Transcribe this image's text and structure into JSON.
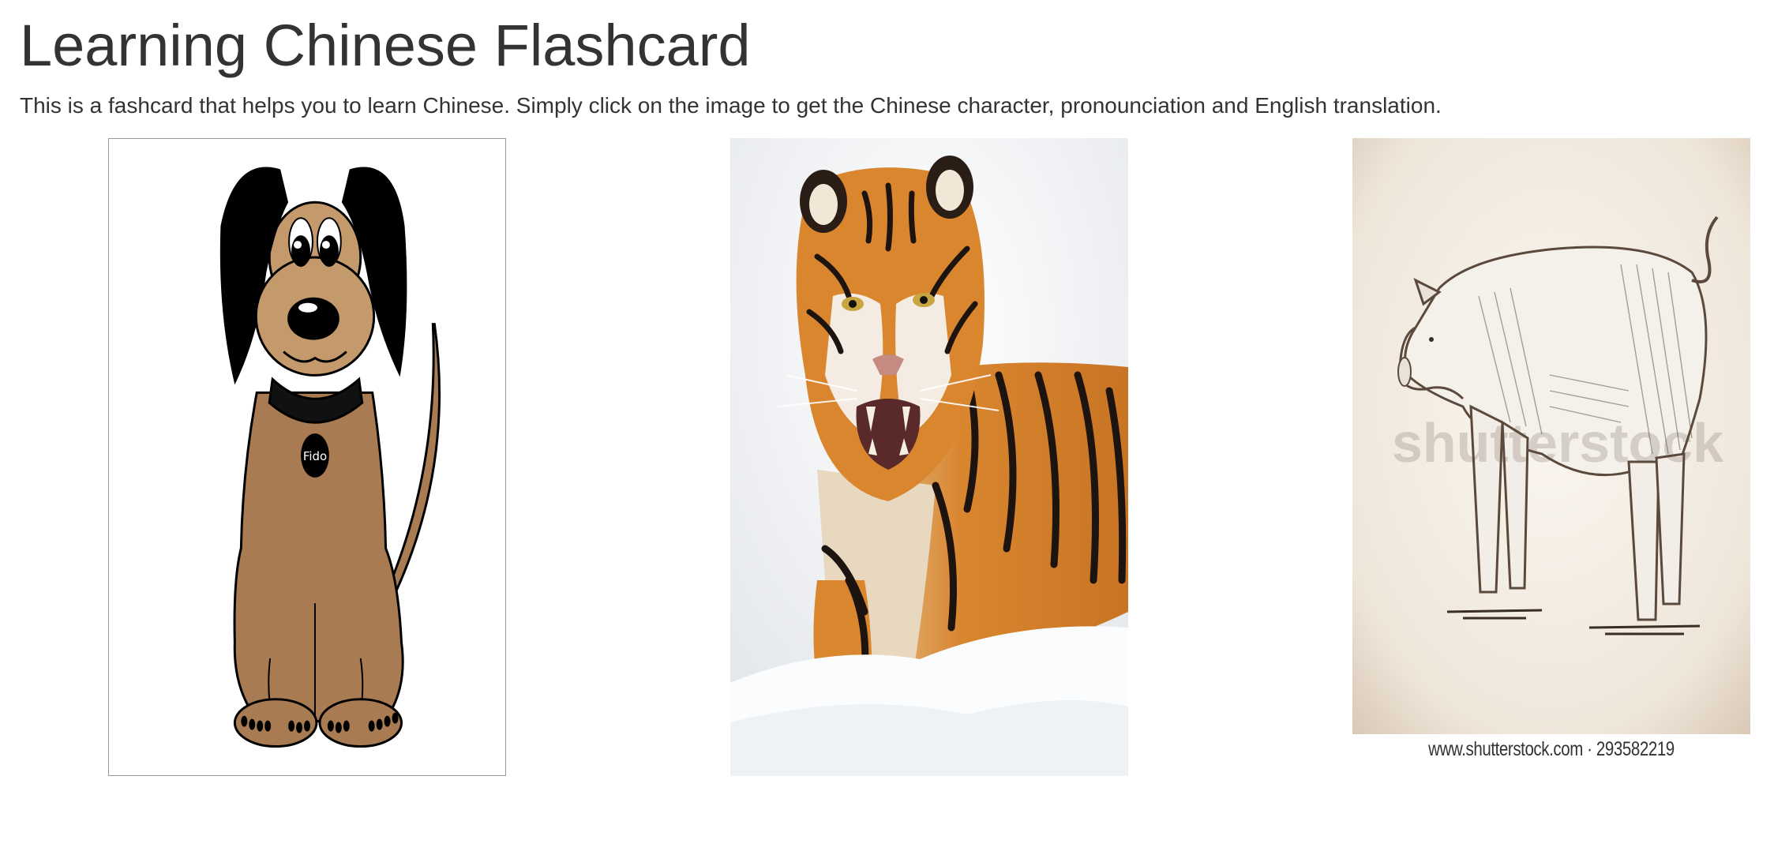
{
  "page": {
    "title": "Learning Chinese Flashcard",
    "description": "This is a fashcard that helps you to learn Chinese. Simply click on the image to get the Chinese character, pronounciation and English translation."
  },
  "cards": [
    {
      "name": "dog",
      "collar_tag": "Fido",
      "icon": "dog-cartoon-image"
    },
    {
      "name": "tiger",
      "icon": "tiger-photo-image"
    },
    {
      "name": "pig",
      "caption": "www.shutterstock.com · 293582219",
      "watermark": "shutterstock",
      "icon": "pig-engraving-image"
    }
  ],
  "colors": {
    "text": "#333333",
    "dog_body": "#a97b52",
    "dog_face": "#c49a6c",
    "tiger_orange": "#d9862f",
    "pig_background": "#efe6da"
  }
}
